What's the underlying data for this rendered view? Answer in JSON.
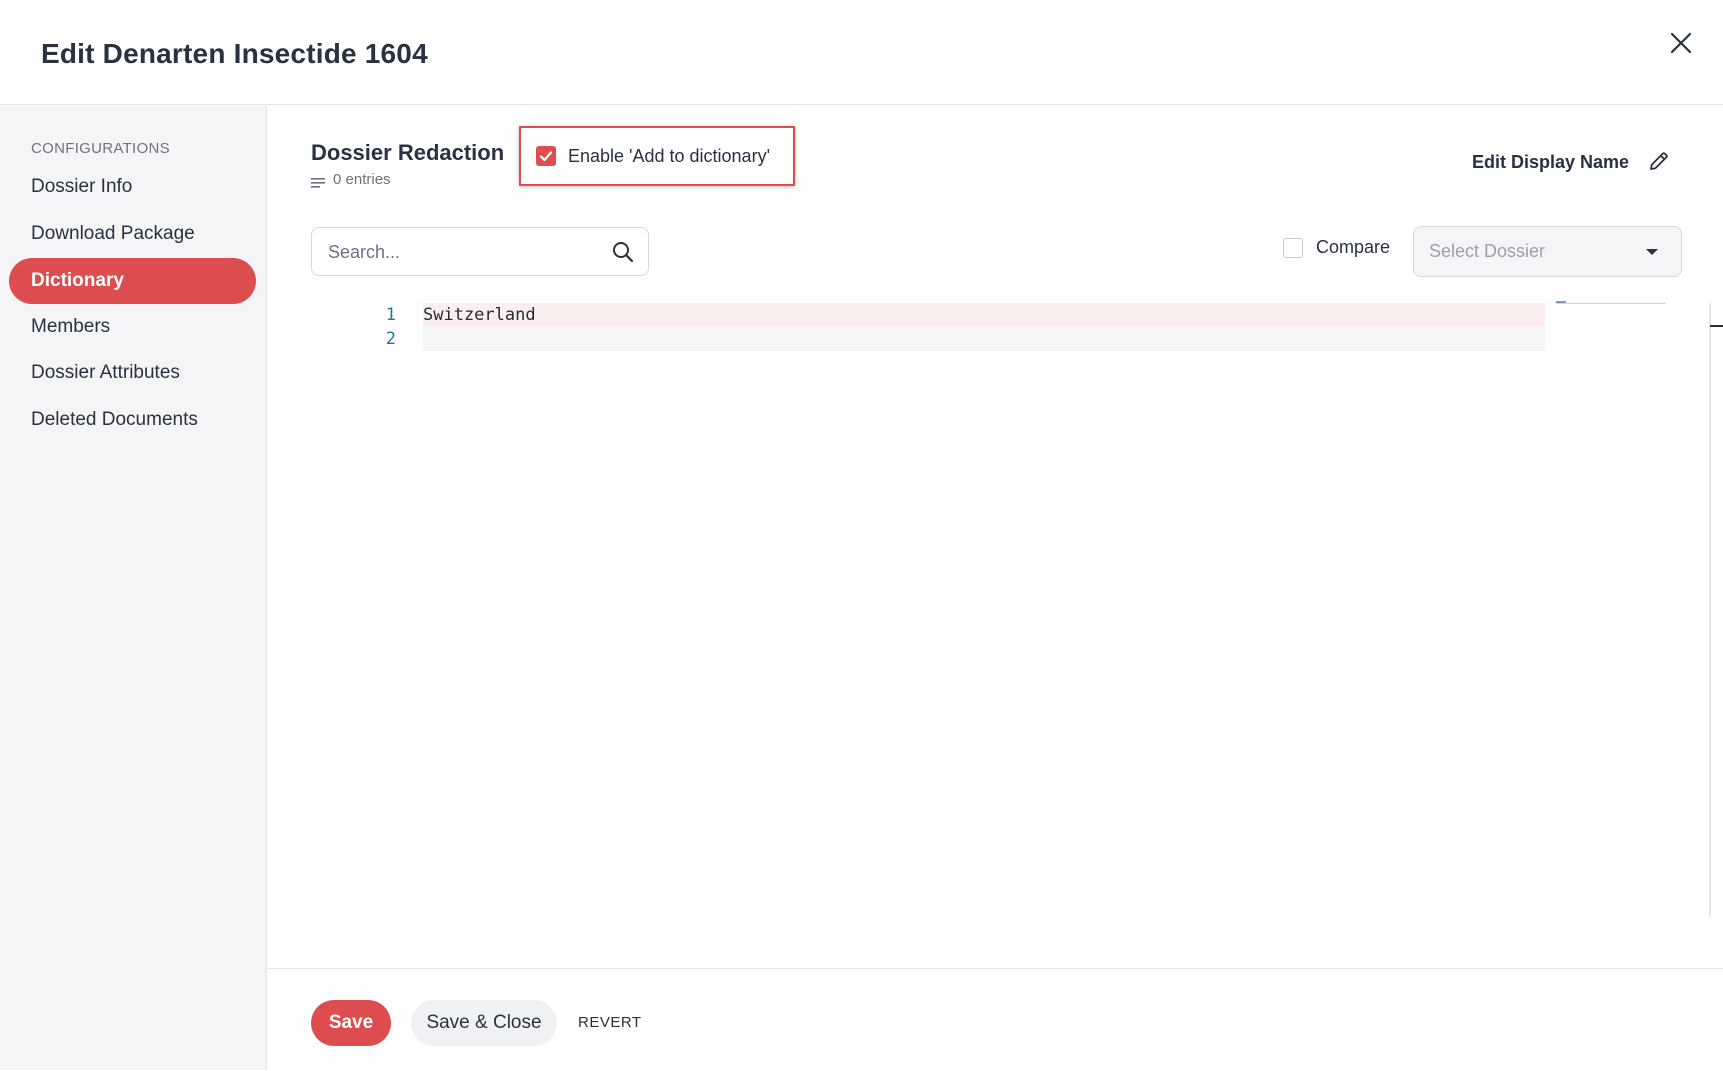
{
  "header": {
    "title": "Edit Denarten Insectide 1604",
    "close_icon": "close-icon"
  },
  "sidebar": {
    "heading": "CONFIGURATIONS",
    "items": [
      {
        "label": "Dossier Info",
        "active": false
      },
      {
        "label": "Download Package",
        "active": false
      },
      {
        "label": "Dictionary",
        "active": true
      },
      {
        "label": "Members",
        "active": false
      },
      {
        "label": "Dossier Attributes",
        "active": false
      },
      {
        "label": "Deleted Documents",
        "active": false
      }
    ]
  },
  "main": {
    "section_title": "Dossier Redaction",
    "entries_text": "0 entries",
    "enable_checkbox": {
      "label": "Enable 'Add to dictionary'",
      "checked": true
    },
    "edit_display_name": "Edit Display Name",
    "search": {
      "placeholder": "Search...",
      "value": ""
    },
    "compare": {
      "label": "Compare",
      "checked": false
    },
    "select_dossier": {
      "placeholder": "Select Dossier"
    },
    "editor": {
      "lines": [
        {
          "number": "1",
          "text": "Switzerland"
        },
        {
          "number": "2",
          "text": ""
        }
      ]
    }
  },
  "footer": {
    "save": "Save",
    "save_close": "Save & Close",
    "revert": "REVERT"
  },
  "colors": {
    "accent": "#dd4d50",
    "text": "#283241",
    "muted": "#6b7280",
    "sidebar_bg": "#f5f5f7"
  }
}
